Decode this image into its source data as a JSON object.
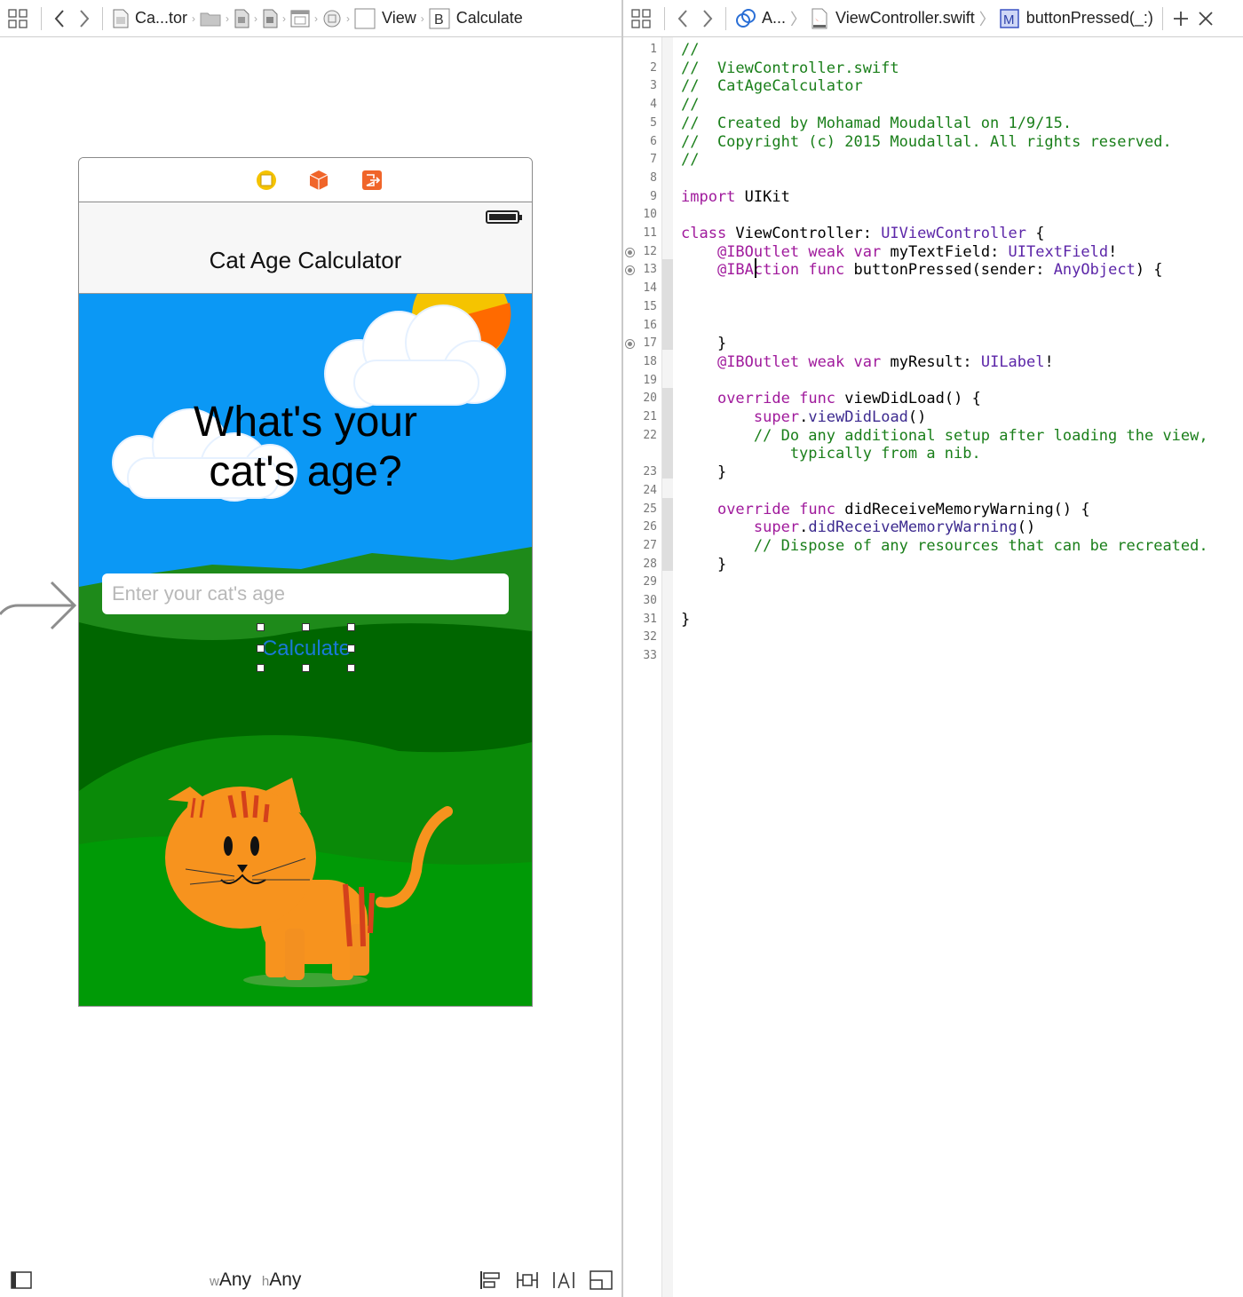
{
  "ib_jumpbar": {
    "items": [
      {
        "label": "Ca...tor",
        "icon": "storyboard-file-icon"
      },
      {
        "label": "",
        "icon": "folder-icon"
      },
      {
        "label": "",
        "icon": "scene-icon"
      },
      {
        "label": "",
        "icon": "view-controller-scene-icon"
      },
      {
        "label": "",
        "icon": "view-controller-icon"
      },
      {
        "label": "",
        "icon": "navigation-item-icon"
      },
      {
        "label": "View",
        "icon": "view-icon"
      },
      {
        "label": "Calculate",
        "icon": "button-b-icon"
      }
    ]
  },
  "code_jumpbar": {
    "items": [
      {
        "label": "A...",
        "icon": "automatic-icon"
      },
      {
        "label": "ViewController.swift",
        "icon": "swift-file-icon"
      },
      {
        "label": "buttonPressed(_:)",
        "icon": "method-m-icon"
      }
    ]
  },
  "scene": {
    "title": "Cat Age Calculator",
    "question_line1": "What's your",
    "question_line2": "cat's age?",
    "textfield_placeholder": "Enter your cat's age",
    "button_label": "Calculate",
    "colors": {
      "sky": "#0b98f5",
      "grass": "#009a06",
      "dark_grass": "#006600",
      "cat": "#f7931e",
      "button_text": "#1a7ad8"
    }
  },
  "bottom_bar": {
    "w_prefix": "w",
    "w_value": "Any",
    "h_prefix": "h",
    "h_value": "Any"
  },
  "editor": {
    "line_numbers": [
      "1",
      "2",
      "3",
      "4",
      "5",
      "6",
      "7",
      "8",
      "9",
      "10",
      "11",
      "12",
      "13",
      "14",
      "15",
      "16",
      "17",
      "18",
      "19",
      "20",
      "21",
      "22",
      "23",
      "24",
      "25",
      "26",
      "27",
      "28",
      "29",
      "30",
      "31",
      "32",
      "33"
    ],
    "lines": [
      {
        "n": "1",
        "segments": [
          {
            "t": "//",
            "c": "cm"
          }
        ]
      },
      {
        "n": "2",
        "segments": [
          {
            "t": "//  ViewController.swift",
            "c": "cm"
          }
        ]
      },
      {
        "n": "3",
        "segments": [
          {
            "t": "//  CatAgeCalculator",
            "c": "cm"
          }
        ]
      },
      {
        "n": "4",
        "segments": [
          {
            "t": "//",
            "c": "cm"
          }
        ]
      },
      {
        "n": "5",
        "segments": [
          {
            "t": "//  Created by Mohamad Moudallal on 1/9/15.",
            "c": "cm"
          }
        ]
      },
      {
        "n": "6",
        "segments": [
          {
            "t": "//  Copyright (c) 2015 Moudallal. All rights reserved.",
            "c": "cm"
          }
        ]
      },
      {
        "n": "7",
        "segments": [
          {
            "t": "//",
            "c": "cm"
          }
        ]
      },
      {
        "n": "8",
        "segments": []
      },
      {
        "n": "9",
        "segments": [
          {
            "t": "import",
            "c": "kw"
          },
          {
            "t": " UIKit",
            "c": ""
          }
        ]
      },
      {
        "n": "10",
        "segments": []
      },
      {
        "n": "11",
        "segments": [
          {
            "t": "class",
            "c": "kw"
          },
          {
            "t": " ViewController: ",
            "c": ""
          },
          {
            "t": "UIViewController",
            "c": "ty"
          },
          {
            "t": " {",
            "c": ""
          }
        ]
      },
      {
        "n": "12",
        "segments": [
          {
            "t": "    ",
            "c": ""
          },
          {
            "t": "@IBOutlet",
            "c": "kw"
          },
          {
            "t": " ",
            "c": ""
          },
          {
            "t": "weak",
            "c": "kw"
          },
          {
            "t": " ",
            "c": ""
          },
          {
            "t": "var",
            "c": "kw"
          },
          {
            "t": " myTextField: ",
            "c": ""
          },
          {
            "t": "UITextField",
            "c": "ty"
          },
          {
            "t": "!",
            "c": ""
          }
        ]
      },
      {
        "n": "13",
        "segments": [
          {
            "t": "    ",
            "c": ""
          },
          {
            "t": "@IBAction",
            "c": "kw"
          },
          {
            "t": " ",
            "c": ""
          },
          {
            "t": "func",
            "c": "kw"
          },
          {
            "t": " buttonPressed(sender: ",
            "c": ""
          },
          {
            "t": "AnyObject",
            "c": "ty"
          },
          {
            "t": ") {",
            "c": ""
          }
        ]
      },
      {
        "n": "14",
        "segments": []
      },
      {
        "n": "15",
        "segments": []
      },
      {
        "n": "16",
        "segments": []
      },
      {
        "n": "17",
        "segments": [
          {
            "t": "    }",
            "c": ""
          }
        ]
      },
      {
        "n": "18",
        "segments": [
          {
            "t": "    ",
            "c": ""
          },
          {
            "t": "@IBOutlet",
            "c": "kw"
          },
          {
            "t": " ",
            "c": ""
          },
          {
            "t": "weak",
            "c": "kw"
          },
          {
            "t": " ",
            "c": ""
          },
          {
            "t": "var",
            "c": "kw"
          },
          {
            "t": " myResult: ",
            "c": ""
          },
          {
            "t": "UILabel",
            "c": "ty"
          },
          {
            "t": "!",
            "c": ""
          }
        ]
      },
      {
        "n": "19",
        "segments": []
      },
      {
        "n": "20",
        "segments": [
          {
            "t": "    ",
            "c": ""
          },
          {
            "t": "override",
            "c": "kw"
          },
          {
            "t": " ",
            "c": ""
          },
          {
            "t": "func",
            "c": "kw"
          },
          {
            "t": " viewDidLoad() {",
            "c": ""
          }
        ]
      },
      {
        "n": "21",
        "segments": [
          {
            "t": "        ",
            "c": ""
          },
          {
            "t": "super",
            "c": "kw"
          },
          {
            "t": ".",
            "c": ""
          },
          {
            "t": "viewDidLoad",
            "c": "mb"
          },
          {
            "t": "()",
            "c": ""
          }
        ]
      },
      {
        "n": "22",
        "segments": [
          {
            "t": "        // Do any additional setup after loading the view,",
            "c": "cm"
          }
        ]
      },
      {
        "n": "",
        "segments": [
          {
            "t": "            typically from a nib.",
            "c": "cm"
          }
        ]
      },
      {
        "n": "23",
        "segments": [
          {
            "t": "    }",
            "c": ""
          }
        ]
      },
      {
        "n": "24",
        "segments": []
      },
      {
        "n": "25",
        "segments": [
          {
            "t": "    ",
            "c": ""
          },
          {
            "t": "override",
            "c": "kw"
          },
          {
            "t": " ",
            "c": ""
          },
          {
            "t": "func",
            "c": "kw"
          },
          {
            "t": " didReceiveMemoryWarning() {",
            "c": ""
          }
        ]
      },
      {
        "n": "26",
        "segments": [
          {
            "t": "        ",
            "c": ""
          },
          {
            "t": "super",
            "c": "kw"
          },
          {
            "t": ".",
            "c": ""
          },
          {
            "t": "didReceiveMemoryWarning",
            "c": "mb"
          },
          {
            "t": "()",
            "c": ""
          }
        ]
      },
      {
        "n": "27",
        "segments": [
          {
            "t": "        // Dispose of any resources that can be recreated.",
            "c": "cm"
          }
        ]
      },
      {
        "n": "28",
        "segments": [
          {
            "t": "    }",
            "c": ""
          }
        ]
      },
      {
        "n": "29",
        "segments": []
      },
      {
        "n": "30",
        "segments": []
      },
      {
        "n": "31",
        "segments": [
          {
            "t": "}",
            "c": ""
          }
        ]
      },
      {
        "n": "32",
        "segments": []
      },
      {
        "n": "33",
        "segments": []
      }
    ],
    "connected_lines": [
      "12",
      "13",
      "17"
    ]
  }
}
